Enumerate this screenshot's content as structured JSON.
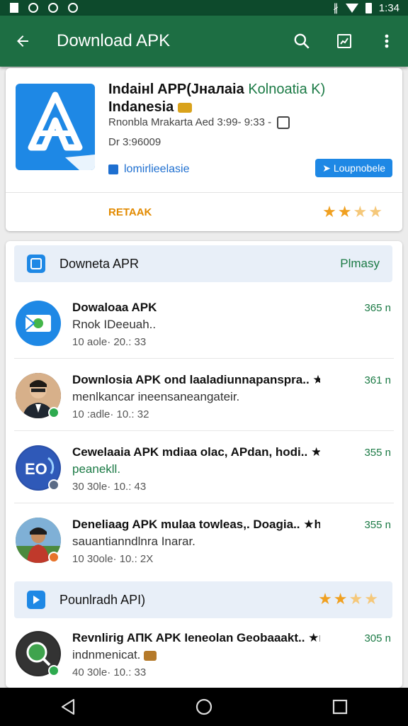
{
  "status_bar": {
    "time": "1:34"
  },
  "app_bar": {
    "title": "Download APK"
  },
  "hero": {
    "title_line1": "Indaінl APP(Jналaia",
    "title_green": "Kolnoatia K)",
    "title_line2": "Indanesia",
    "meta": "Rnonbla Mrakarta Aed 3:99- 9:33 -",
    "size": "Dr 3:96009",
    "download_label": "lomirlieelasie",
    "button_label": "Loupnobele",
    "rating_label": "RETAAK"
  },
  "list": {
    "section1": {
      "label": "Downeta APR",
      "right": "Plmasy"
    },
    "section2": {
      "label": "Pounlradh API)"
    },
    "rows": [
      {
        "title": "Dowaloaa APK",
        "subtitle": "Rnok IDeeuah..",
        "meta": "10 aole· 20.: 33",
        "size": "365 n",
        "sub_green": false
      },
      {
        "title": "Downlosia APK ond laaladiunnapanspra.. ★r..",
        "subtitle": "menlkancar ineensaneangateir.",
        "meta": "10 :adle· 10.: 32",
        "size": "361 n",
        "sub_green": false
      },
      {
        "title": "Cewelaaia APK mdiaa olac, APdan, hodi.. ★k",
        "subtitle": "peanekll.",
        "meta": "30 30le· 10.: 43",
        "size": "355 n",
        "sub_green": true
      },
      {
        "title": "Deneliaag APK mulaa towleas,. Doagia.. ★h..",
        "subtitle": "sauantianndlnra Inarar.",
        "meta": "10 30ole· 10.: 2X",
        "size": "355 n",
        "sub_green": false
      },
      {
        "title": "Revnlirig AΠK APK Ieneolan Geobaaakt.. ★ns",
        "subtitle": "indnmenicat. ",
        "meta": "40 30le· 10.: 33",
        "size": "305 n",
        "sub_green": false
      }
    ]
  },
  "colors": {
    "app_bar": "#1d6e43",
    "accent_blue": "#1e88e5",
    "green_text": "#1b7a45",
    "star": "#f0a020"
  }
}
